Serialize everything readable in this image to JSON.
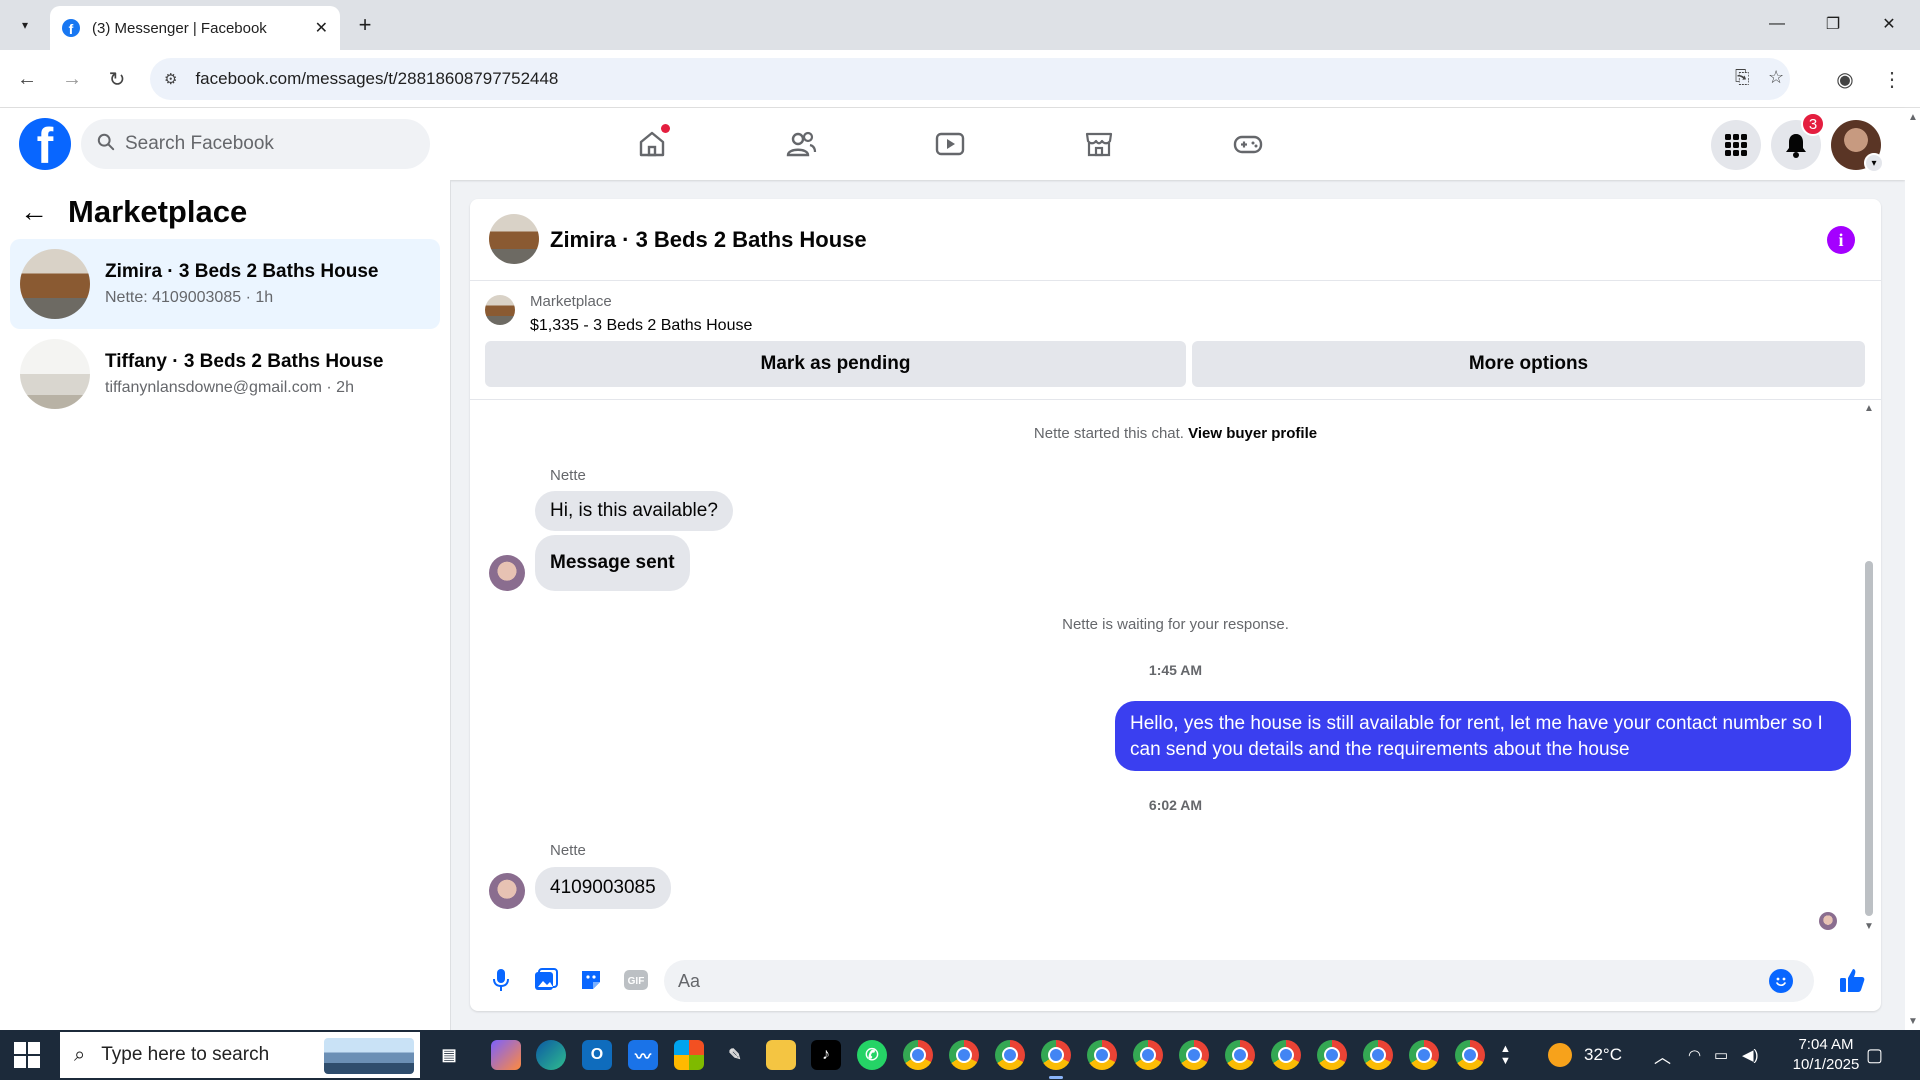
{
  "browser": {
    "tab_title": "(3) Messenger | Facebook",
    "tab_favicon": "f",
    "url": "facebook.com/messages/t/28818608797752448",
    "icons": [
      "tab-search-icon",
      "close-icon",
      "new-tab-icon",
      "minimize-icon",
      "restore-icon",
      "close-window-icon",
      "back-icon",
      "forward-icon",
      "reload-icon",
      "site-info-icon",
      "install-icon",
      "star-icon",
      "profile-icon",
      "menu-icon"
    ]
  },
  "facebook": {
    "logo": "f",
    "search_placeholder": "Search Facebook",
    "nav": [
      "home-icon",
      "friends-icon",
      "video-icon",
      "marketplace-icon",
      "gaming-icon"
    ],
    "notifications_count": "3",
    "brand_color": "#0866ff",
    "accent_message_color": "#3a3ff0",
    "badge_color": "#e41e3f"
  },
  "sidebar": {
    "title": "Marketplace",
    "conversations": [
      {
        "name": "Zimira · 3 Beds 2 Baths House",
        "preview": "Nette: 4109003085 · 1h",
        "active": true
      },
      {
        "name": "Tiffany · 3 Beds 2 Baths House",
        "preview": "tiffanynlansdowne@gmail.com · 2h",
        "active": false
      }
    ]
  },
  "chat": {
    "title": "Zimira · 3 Beds 2 Baths House",
    "listing_source": "Marketplace",
    "listing_price": "$1,335 - 3 Beds 2 Baths House",
    "mark_pending_label": "Mark as pending",
    "more_options_label": "More options",
    "started_text": "Nette started this chat.",
    "view_profile_label": "View buyer profile",
    "sender_name": "Nette",
    "msg1": "Hi, is this available?",
    "msg2": "Message sent",
    "waiting_text": "Nette is waiting for your response.",
    "time1": "1:45 AM",
    "reply": "Hello, yes the house is still available for rent, let me have your contact number so I can send you details and the requirements about the house",
    "time2": "6:02 AM",
    "sender_name2": "Nette",
    "msg3": "4109003085",
    "composer_placeholder": "Aa"
  },
  "taskbar": {
    "search_placeholder": "Type here to search",
    "weather": "32°C",
    "time": "7:04 AM",
    "date": "10/1/2025"
  }
}
